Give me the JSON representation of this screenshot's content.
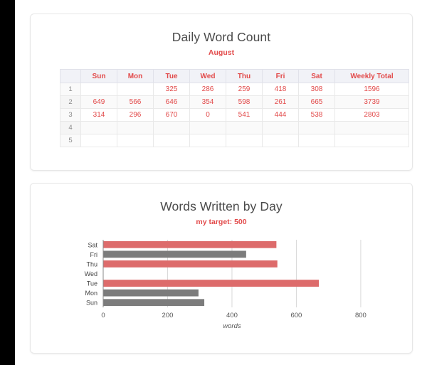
{
  "table_card": {
    "title": "Daily Word Count",
    "subtitle": "August",
    "columns": [
      "",
      "Sun",
      "Mon",
      "Tue",
      "Wed",
      "Thu",
      "Fri",
      "Sat",
      "Weekly Total"
    ],
    "rows": [
      {
        "num": "1",
        "cells": [
          "",
          "",
          "325",
          "286",
          "259",
          "418",
          "308"
        ],
        "total": "1596"
      },
      {
        "num": "2",
        "cells": [
          "649",
          "566",
          "646",
          "354",
          "598",
          "261",
          "665"
        ],
        "total": "3739"
      },
      {
        "num": "3",
        "cells": [
          "314",
          "296",
          "670",
          "0",
          "541",
          "444",
          "538"
        ],
        "total": "2803"
      },
      {
        "num": "4",
        "cells": [
          "",
          "",
          "",
          "",
          "",
          "",
          ""
        ],
        "total": ""
      },
      {
        "num": "5",
        "cells": [
          "",
          "",
          "",
          "",
          "",
          "",
          ""
        ],
        "total": ""
      }
    ]
  },
  "chart_card": {
    "title": "Words Written by Day",
    "subtitle": "my target: 500"
  },
  "chart_data": {
    "type": "bar",
    "orientation": "horizontal",
    "title": "Words Written by Day",
    "subtitle": "my target: 500",
    "xlabel": "words",
    "ylabel": "",
    "xlim": [
      0,
      840
    ],
    "xticks": [
      0,
      200,
      400,
      600,
      800
    ],
    "xtick_labels": [
      "0",
      "200",
      "400",
      "600",
      "800"
    ],
    "grid": true,
    "grid_axis": "x",
    "legend": "none",
    "target": 500,
    "categories": [
      "Sat",
      "Fri",
      "Thu",
      "Wed",
      "Tue",
      "Mon",
      "Sun"
    ],
    "values": [
      538,
      444,
      541,
      0,
      670,
      296,
      314
    ],
    "bar_colors": [
      "#dd6b6b",
      "#7c7c7c",
      "#dd6b6b",
      "#dd6b6b",
      "#dd6b6b",
      "#7c7c7c",
      "#7c7c7c"
    ],
    "colors": {
      "above_target": "#dd6b6b",
      "below_target": "#7c7c7c",
      "grid": "#d8d8d8",
      "axis": "#8a8a8a",
      "tick_text": "#555555"
    }
  }
}
